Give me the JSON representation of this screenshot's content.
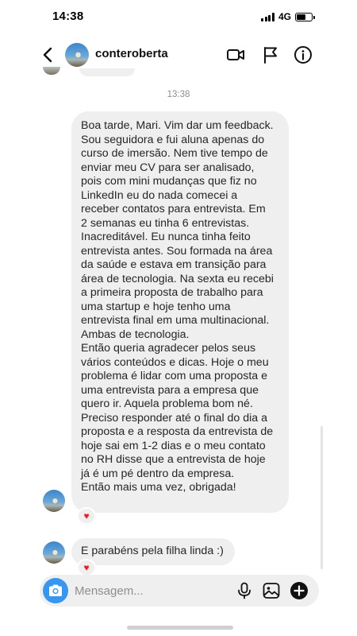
{
  "status_bar": {
    "time": "14:38",
    "network": "4G",
    "battery_level_percent": 62
  },
  "header": {
    "username": "conteroberta",
    "icons": [
      "back-arrow-icon",
      "video-call-icon",
      "flag-icon",
      "info-icon"
    ]
  },
  "thread": {
    "timestamp": "13:38",
    "messages": [
      {
        "lines": [
          "Boa tarde, Mari. Vim dar um feedback.",
          "Sou seguidora e fui aluna apenas do",
          "curso  de imersão. Nem tive tempo de",
          "enviar meu CV para ser analisado,",
          "pois com mini mudanças que fiz no",
          "LinkedIn eu do nada comecei a",
          "receber contatos para entrevista. Em",
          "2 semanas eu tinha 6 entrevistas.",
          "Inacreditável. Eu nunca tinha feito",
          "entrevista antes. Sou formada na área",
          "da saúde e estava em transição para",
          "área de tecnologia. Na sexta eu recebi",
          "a primeira proposta de trabalho para",
          "uma startup e hoje tenho uma",
          "entrevista final em uma multinacional.",
          "Ambas de tecnologia.",
          "Então queria agradecer pelos seus",
          "vários conteúdos e dicas. Hoje o meu",
          "problema é lidar com uma proposta e",
          "uma entrevista para a empresa que",
          "quero ir. Aquela problema bom né.",
          "Preciso responder até o final do dia a",
          "proposta e a resposta da entrevista de",
          "hoje sai em 1-2 dias e o meu contato",
          "no RH disse que a entrevista de hoje",
          "já é um pé dentro da empresa.",
          "Então mais uma vez, obrigada!"
        ],
        "reaction": "♥"
      },
      {
        "text": "E parabéns pela filha linda :)",
        "reaction": "♥"
      }
    ]
  },
  "composer": {
    "placeholder": "Mensagem...",
    "icons": [
      "camera-icon",
      "microphone-icon",
      "gallery-icon",
      "add-icon"
    ]
  },
  "colors": {
    "bubble_bg": "#efefef",
    "accent_blue": "#3797f0",
    "reaction_red": "#ed1c24",
    "timestamp_gray": "#8e8e8e"
  }
}
